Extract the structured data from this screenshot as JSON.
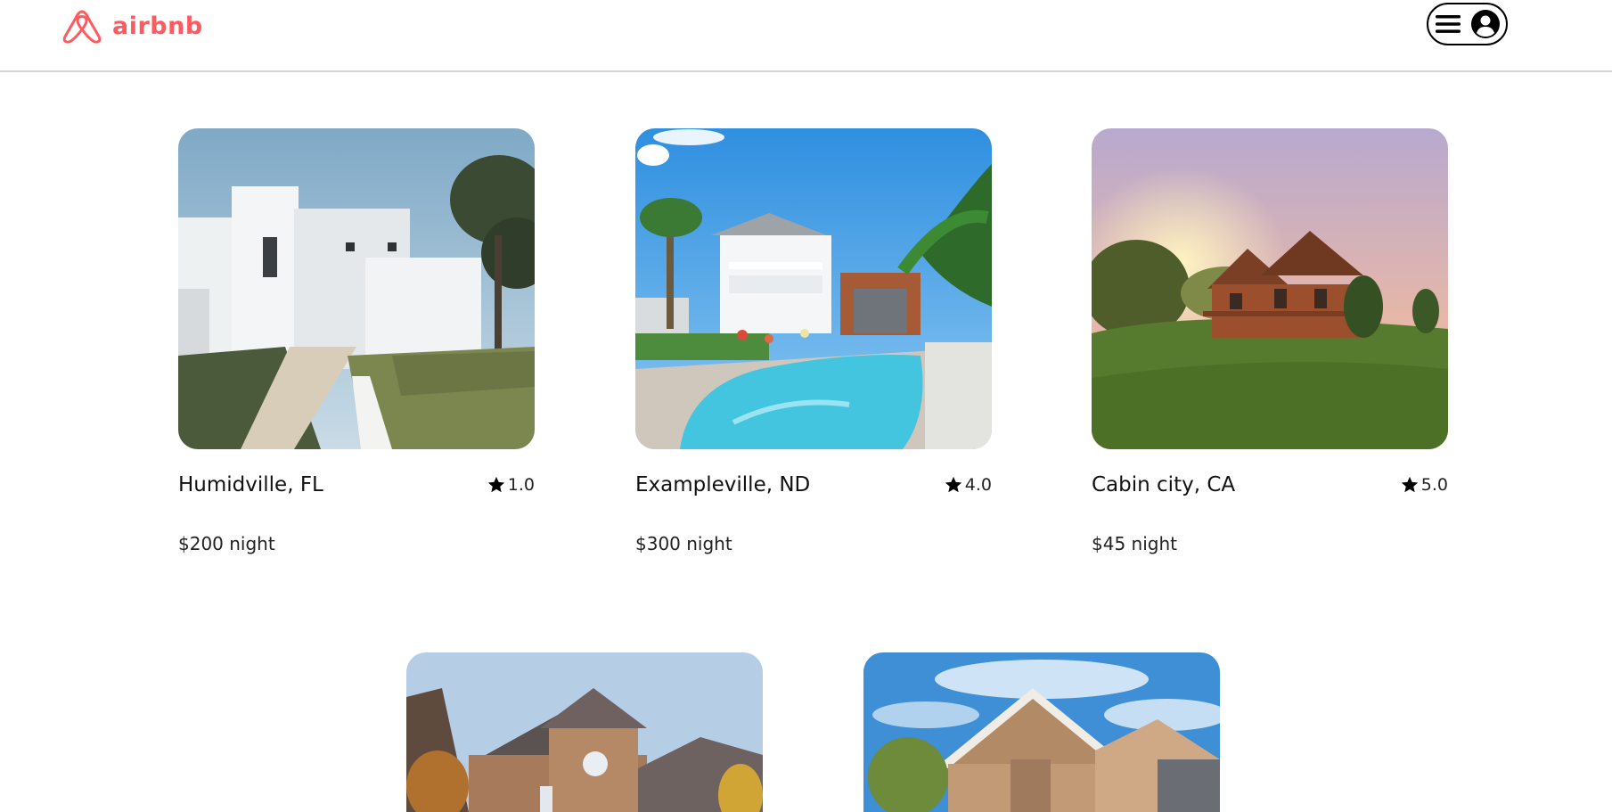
{
  "header": {
    "logo_text": "airbnb",
    "brand_color": "#ff5a5f",
    "menu_icon": "hamburger-icon",
    "user_icon": "user-circle-icon"
  },
  "listings": [
    {
      "title": "Humidville, FL",
      "rating": "1.0",
      "price": "$200 night",
      "image": "white-modern-house"
    },
    {
      "title": "Exampleville, ND",
      "rating": "4.0",
      "price": "$300 night",
      "image": "house-with-pool"
    },
    {
      "title": "Cabin city, CA",
      "rating": "5.0",
      "price": "$45 night",
      "image": "wooden-cabin-sunset"
    },
    {
      "image": "brick-suburban-house"
    },
    {
      "image": "stone-house-blue-sky"
    }
  ]
}
